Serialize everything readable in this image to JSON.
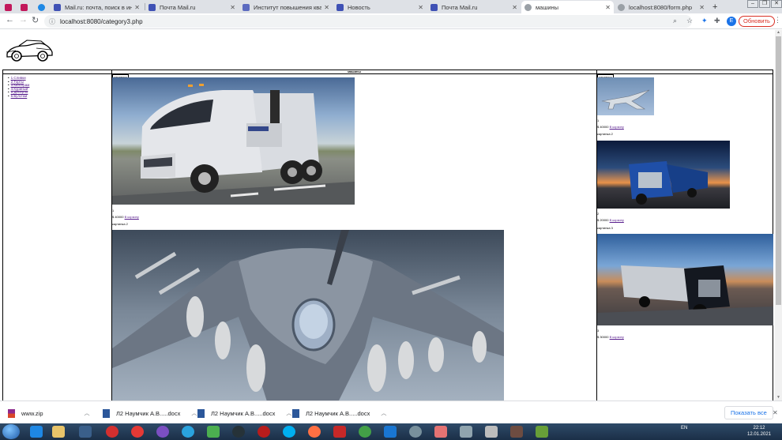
{
  "browser": {
    "tabs": [
      {
        "title": "",
        "icon": "k-app-icon",
        "active": false
      },
      {
        "title": "",
        "icon": "k-app-icon",
        "active": false
      },
      {
        "title": "",
        "icon": "app-icon",
        "active": false
      },
      {
        "title": "Mail.ru: почта, поиск в интерн...",
        "icon": "mail-icon",
        "active": false
      },
      {
        "title": "Почта Mail.ru",
        "icon": "mail-icon",
        "active": false
      },
      {
        "title": "Институт повышения квалиф...",
        "icon": "doc-icon",
        "active": false
      },
      {
        "title": "Новость",
        "icon": "mail-icon",
        "active": false
      },
      {
        "title": "Почта Mail.ru",
        "icon": "mail-icon",
        "active": false
      },
      {
        "title": "машины",
        "icon": "globe-icon",
        "active": true
      },
      {
        "title": "localhost:8080/form.php",
        "icon": "globe-icon",
        "active": false
      }
    ],
    "new_tab": "+",
    "url": "localhost:8080/category3.php",
    "profile_letter": "Е",
    "update_label": "Обновить",
    "accent": "#1a73e8"
  },
  "page": {
    "header_title": "машины",
    "menu": [
      "1.Сливки",
      "2.Торты",
      "3.Килограм",
      "4.Куриный",
      "5.Десерты",
      "6.Булочки"
    ],
    "mid": {
      "caption1": "картинка",
      "item1_number": "1",
      "item1_price": "$ 40000",
      "item1_link": "В корзину",
      "caption2": "картинка 2"
    },
    "right": {
      "caption1": "картинка",
      "item1_number": "1",
      "item1_price": "$ 40000",
      "item1_link": "В корзину",
      "caption2": "картинка 2",
      "item2_number": "2",
      "item2_price": "$ 20000",
      "item2_link": "В корзину",
      "caption3": "картинка 3",
      "item3_number": "3",
      "item3_price": "$ 30000",
      "item3_link": "В корзину"
    }
  },
  "downloads": {
    "items": [
      "www.zip",
      "Л2 Наумчик А.В.....docx",
      "Л2 Наумчик А.В.....docx",
      "Л2 Наумчик А.В.....docx"
    ],
    "show_all": "Показать все"
  },
  "taskbar": {
    "lang": "EN",
    "time": "22:12",
    "date": "12.01.2021"
  }
}
